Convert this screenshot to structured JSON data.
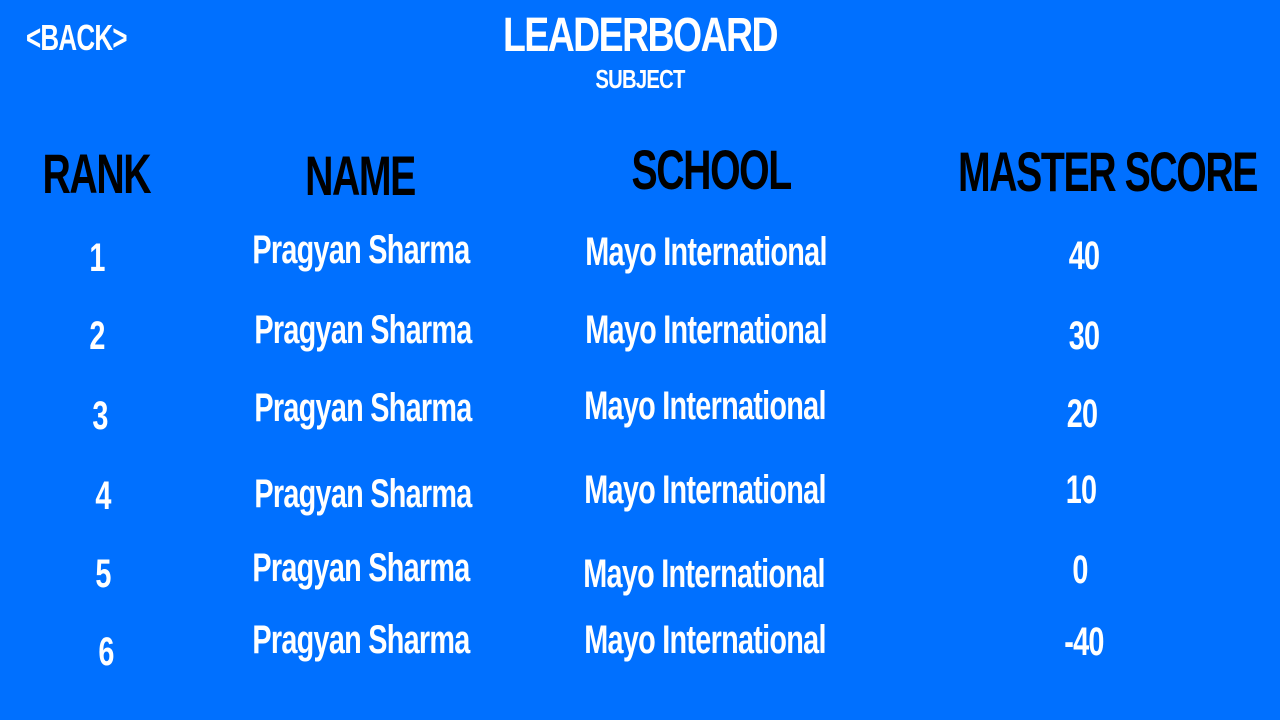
{
  "nav": {
    "back_label": "<BACK>"
  },
  "header": {
    "title": "LEADERBOARD",
    "subtitle": "SUBJECT"
  },
  "table": {
    "columns": [
      "RANK",
      "NAME",
      "SCHOOL",
      "MASTER SCORE"
    ],
    "rows": [
      {
        "rank": "1",
        "name": "Pragyan Sharma",
        "school": "Mayo International",
        "score": "40"
      },
      {
        "rank": "2",
        "name": "Pragyan Sharma",
        "school": "Mayo International",
        "score": "30"
      },
      {
        "rank": "3",
        "name": "Pragyan Sharma",
        "school": "Mayo International",
        "score": "20"
      },
      {
        "rank": "4",
        "name": "Pragyan Sharma",
        "school": "Mayo International",
        "score": "10"
      },
      {
        "rank": "5",
        "name": "Pragyan Sharma",
        "school": "Mayo International",
        "score": "0"
      },
      {
        "rank": "6",
        "name": "Pragyan Sharma",
        "school": "Mayo International",
        "score": "-40"
      }
    ]
  },
  "colors": {
    "background": "#0070FF",
    "header_text": "#000000",
    "body_text": "#FFFFFF"
  }
}
